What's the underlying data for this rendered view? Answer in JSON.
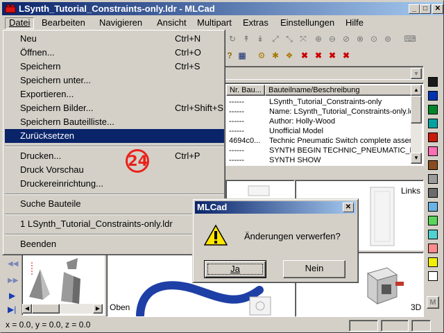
{
  "window": {
    "title": "LSynth_Tutorial_Constraints-only.ldr - MLCad",
    "minimize": "_",
    "maximize": "□",
    "close": "✕"
  },
  "menubar": {
    "items": [
      {
        "label": "Datei"
      },
      {
        "label": "Bearbeiten"
      },
      {
        "label": "Navigieren"
      },
      {
        "label": "Ansicht"
      },
      {
        "label": "Multipart"
      },
      {
        "label": "Extras"
      },
      {
        "label": "Einstellungen"
      },
      {
        "label": "Hilfe"
      }
    ]
  },
  "datei_menu": {
    "items": [
      {
        "label": "Neu",
        "shortcut": "Ctrl+N"
      },
      {
        "label": "Öffnen...",
        "shortcut": "Ctrl+O"
      },
      {
        "label": "Speichern",
        "shortcut": "Ctrl+S"
      },
      {
        "label": "Speichern unter...",
        "shortcut": ""
      },
      {
        "label": "Exportieren...",
        "shortcut": ""
      },
      {
        "label": "Speichern Bilder...",
        "shortcut": "Ctrl+Shift+S"
      },
      {
        "label": "Speichern Bauteilliste...",
        "shortcut": ""
      },
      {
        "label": "Zurücksetzen",
        "shortcut": ""
      },
      {
        "label": "Drucken...",
        "shortcut": "Ctrl+P"
      },
      {
        "label": "Druck Vorschau",
        "shortcut": ""
      },
      {
        "label": "Druckereinrichtung...",
        "shortcut": ""
      },
      {
        "label": "Suche Bauteile",
        "shortcut": ""
      },
      {
        "label": "1 LSynth_Tutorial_Constraints-only.ldr",
        "shortcut": ""
      },
      {
        "label": "Beenden",
        "shortcut": ""
      }
    ],
    "highlighted": "Zurücksetzen"
  },
  "step_badge": "24",
  "parts_list": {
    "columns": [
      "Nr. Bau...",
      "Bauteilname/Beschreibung"
    ],
    "rows": [
      {
        "nr": "------",
        "desc": "LSynth_Tutorial_Constraints-only"
      },
      {
        "nr": "------",
        "desc": "Name: LSynth_Tutorial_Constraints-only.ldr"
      },
      {
        "nr": "------",
        "desc": "Author: Holly-Wood"
      },
      {
        "nr": "------",
        "desc": "Unofficial Model"
      },
      {
        "nr": "4694c0...",
        "desc": "Technic Pneumatic Switch complete assem"
      },
      {
        "nr": "------",
        "desc": "SYNTH BEGIN TECHNIC_PNEUMATIC_H"
      },
      {
        "nr": "------",
        "desc": "SYNTH SHOW"
      }
    ]
  },
  "views": {
    "top_right_label": "Links",
    "bottom_left_label": "Oben",
    "bottom_right_label": "3D"
  },
  "dialog": {
    "title": "MLCad",
    "message": "Änderungen verwerfen?",
    "yes_label": "Ja",
    "no_label": "Nein",
    "close": "✕"
  },
  "palette": {
    "colors": [
      "#1a1a1a",
      "#0033b3",
      "#00852b",
      "#00a3a3",
      "#c91a09",
      "#ff6eb4",
      "#8a4b1f",
      "#9b9b9b",
      "#6b6b6b",
      "#6bb3e6",
      "#5ad45a",
      "#4fd1d1",
      "#ff8c8c",
      "#f0f000",
      "#ffffff"
    ],
    "m_label": "M"
  },
  "statusbar": {
    "coords": "x = 0.0, y = 0.0, z = 0.0"
  }
}
